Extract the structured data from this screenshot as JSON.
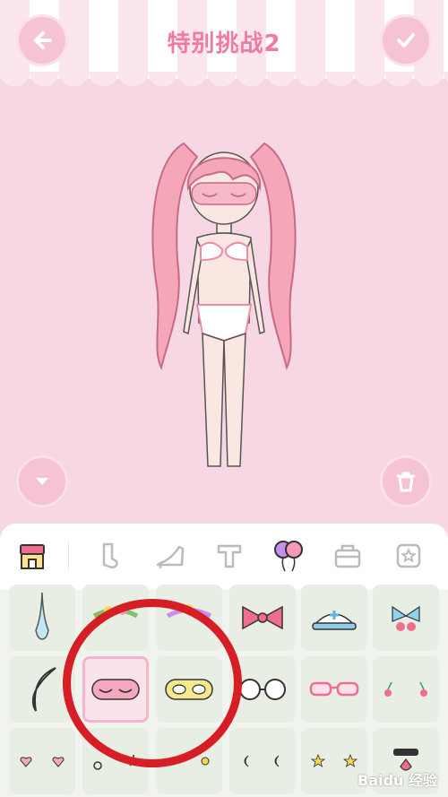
{
  "header": {
    "title": "特别挑战2",
    "back_icon": "arrow-left-icon",
    "confirm_icon": "check-icon"
  },
  "stage": {
    "down_icon": "chevron-down-icon",
    "delete_icon": "trash-icon"
  },
  "categories": [
    {
      "name": "shop-icon",
      "selected": true
    },
    {
      "name": "sock-icon"
    },
    {
      "name": "heel-shoe-icon"
    },
    {
      "name": "text-t-icon"
    },
    {
      "name": "balloons-icon"
    },
    {
      "name": "bag-icon"
    },
    {
      "name": "star-frame-icon"
    }
  ],
  "items": [
    {
      "name": "teardrop-item"
    },
    {
      "name": "flower-crown-item"
    },
    {
      "name": "star-crown-item"
    },
    {
      "name": "bow-item"
    },
    {
      "name": "nurse-cap-item"
    },
    {
      "name": "cherry-ribbon-item"
    },
    {
      "name": "crescent-item"
    },
    {
      "name": "pink-sleep-mask-item",
      "selected": true
    },
    {
      "name": "yellow-sleep-mask-item"
    },
    {
      "name": "round-glasses-item"
    },
    {
      "name": "pink-glasses-item"
    },
    {
      "name": "cherry-pair-item"
    },
    {
      "name": "heart-stickers-item"
    },
    {
      "name": "star-earrings-item"
    },
    {
      "name": "dot-earrings-item"
    },
    {
      "name": "moon-stickers-item"
    },
    {
      "name": "star-stickers-item"
    },
    {
      "name": "choker-item"
    }
  ],
  "colors": {
    "accent": "#f07aa3",
    "button": "#f6c3d3",
    "background": "#f7d7e4",
    "highlight_circle": "#d81e25"
  },
  "watermark": "Baidu 经验"
}
